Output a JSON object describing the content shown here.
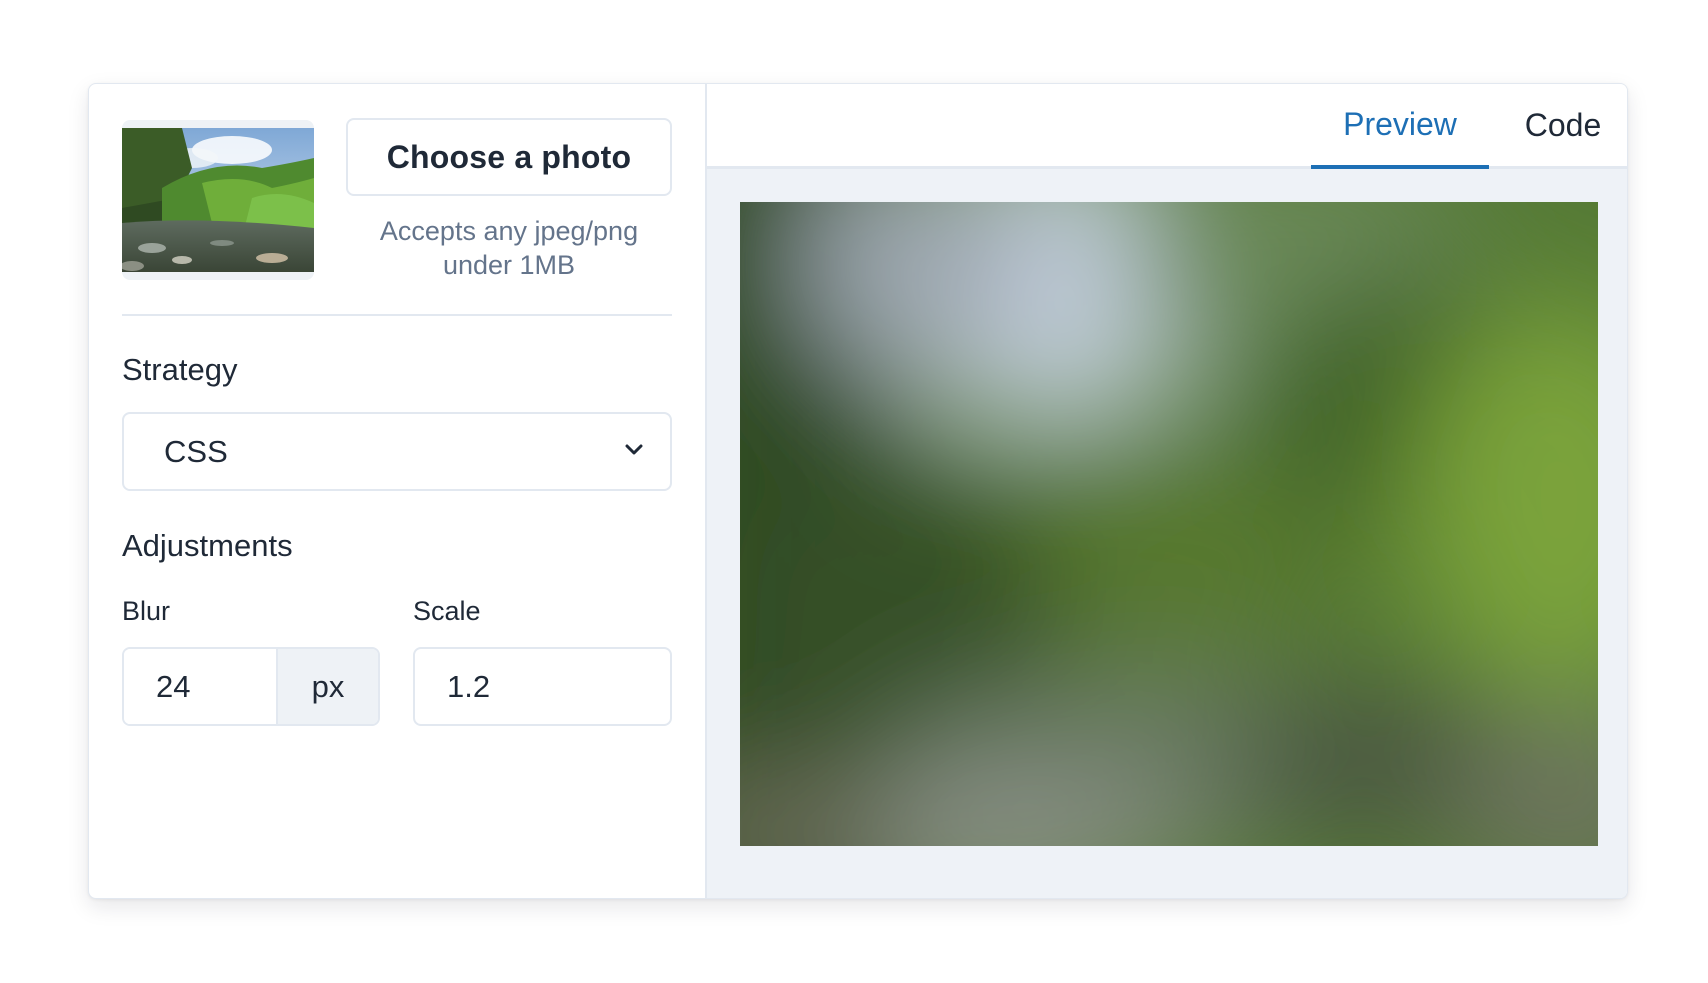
{
  "upload": {
    "button_label": "Choose a photo",
    "hint": "Accepts any jpeg/png under 1MB"
  },
  "strategy": {
    "title": "Strategy",
    "selected": "CSS"
  },
  "adjustments": {
    "title": "Adjustments",
    "blur": {
      "label": "Blur",
      "value": "24",
      "unit": "px"
    },
    "scale": {
      "label": "Scale",
      "value": "1.2"
    }
  },
  "tabs": [
    {
      "label": "Preview",
      "active": true
    },
    {
      "label": "Code",
      "active": false
    }
  ],
  "colors": {
    "accent": "#1d6fb5",
    "border": "#e2e8f0",
    "muted_text": "#64748b",
    "panel_bg": "#eef2f7"
  }
}
